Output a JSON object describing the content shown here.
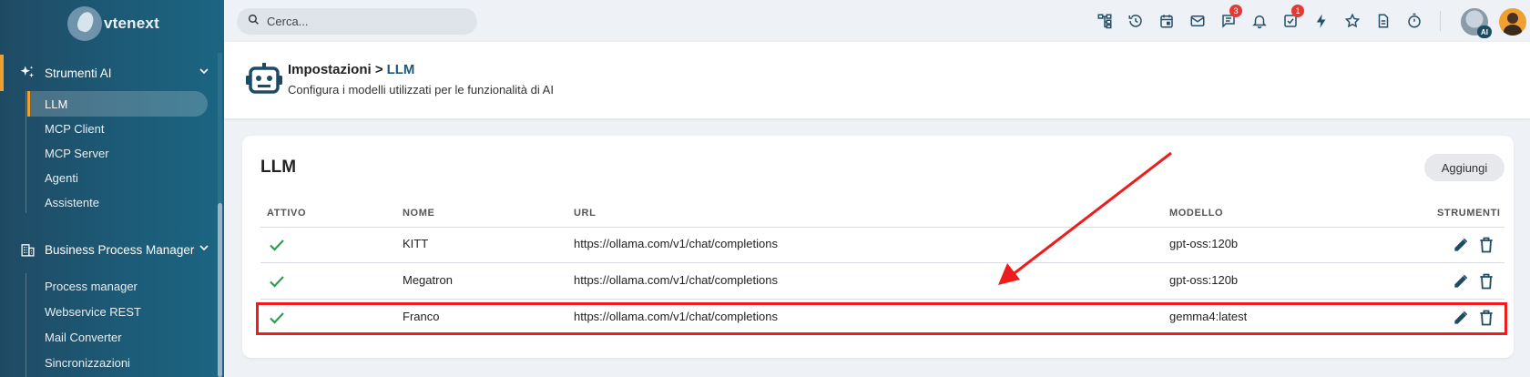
{
  "app": {
    "name": "vtenext"
  },
  "search": {
    "placeholder": "Cerca..."
  },
  "topbar": {
    "icons": [
      "hierarchy-icon",
      "history-icon",
      "calendar-icon",
      "mail-icon",
      "chat-icon",
      "bell-icon",
      "task-check-icon",
      "bolt-icon",
      "star-icon",
      "document-icon",
      "timer-icon"
    ],
    "chat_badge": "3",
    "tasks_badge": "1",
    "avatar_ai_label": "AI"
  },
  "sidebar": {
    "sections": [
      {
        "label": "Strumenti AI",
        "icon": "sparkles-icon",
        "items": [
          "LLM",
          "MCP Client",
          "MCP Server",
          "Agenti",
          "Assistente"
        ],
        "active_item": "LLM"
      },
      {
        "label": "Business Process Manager",
        "icon": "building-icon",
        "items": [
          "Process manager",
          "Webservice REST",
          "Mail Converter",
          "Sincronizzazioni"
        ]
      }
    ]
  },
  "header": {
    "breadcrumb_parent": "Impostazioni >",
    "breadcrumb_current": "LLM",
    "subtitle": "Configura i modelli utilizzati per le funzionalità di AI"
  },
  "card": {
    "title": "LLM",
    "add_button": "Aggiungi",
    "columns": [
      "ATTIVO",
      "NOME",
      "URL",
      "MODELLO",
      "STRUMENTI"
    ],
    "rows": [
      {
        "active": true,
        "name": "KITT",
        "url": "https://ollama.com/v1/chat/completions",
        "model": "gpt-oss:120b"
      },
      {
        "active": true,
        "name": "Megatron",
        "url": "https://ollama.com/v1/chat/completions",
        "model": "gpt-oss:120b"
      },
      {
        "active": true,
        "name": "Franco",
        "url": "https://ollama.com/v1/chat/completions",
        "model": "gemma4:latest"
      }
    ]
  },
  "colors": {
    "accent": "#1d5a7a",
    "active_marker": "#f0a030",
    "check": "#2e9e4f",
    "highlight": "#ee1c1c",
    "badge": "#e53935"
  }
}
